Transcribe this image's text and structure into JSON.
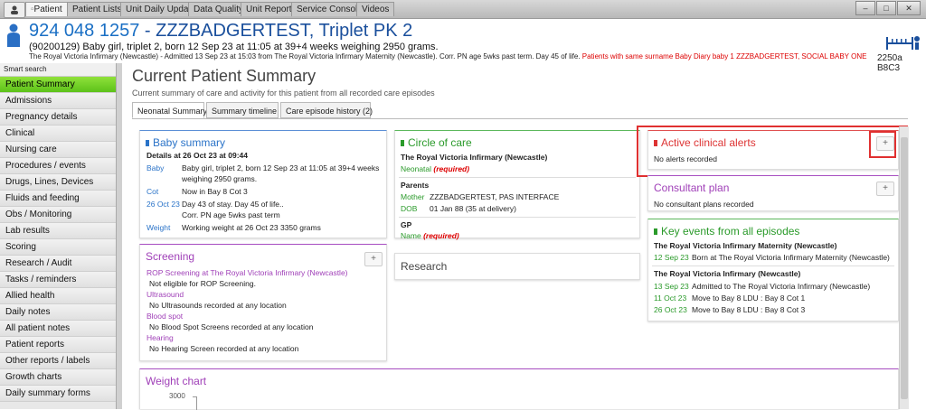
{
  "topbar": {
    "tabs": [
      "Patient",
      "Patient Lists",
      "Unit Daily Update",
      "Data Quality",
      "Unit Reports",
      "Service Console",
      "Videos"
    ],
    "window_buttons": [
      "–",
      "□",
      "✕"
    ]
  },
  "patient": {
    "number": "924 048 1257",
    "name": " - ZZZBADGERTEST, Triplet PK 2",
    "description": "(90200129) Baby girl, triplet 2, born 12 Sep 23 at 11:05 at 39+4 weeks weighing 2950 grams.",
    "admission_line": "The Royal Victoria Infirmary (Newcastle) - Admitted 13 Sep 23 at 15:03 from The Royal Victoria Infirmary Maternity (Newcastle). Corr. PN age 5wks past term. Day 45 of life. ",
    "alert_line": "Patients with same surname Baby Diary baby 1 ZZZBADGERTEST, SOCIAL BABY ONE",
    "bed_code": "2250a B8C3"
  },
  "sidebar": {
    "smart_search": "Smart search",
    "items": [
      "Patient Summary",
      "Admissions",
      "Pregnancy details",
      "Clinical",
      "Nursing care",
      "Procedures / events",
      "Drugs, Lines, Devices",
      "Fluids and feeding",
      "Obs / Monitoring",
      "Lab results",
      "Scoring",
      "Research / Audit",
      "Tasks / reminders",
      "Allied health",
      "Daily notes",
      "All patient notes",
      "Patient reports",
      "Other reports / labels",
      "Growth charts",
      "Daily summary forms"
    ]
  },
  "main": {
    "title": "Current Patient Summary",
    "subtitle": "Current summary of care and activity for this patient from all recorded care episodes",
    "tabs": [
      "Neonatal Summary",
      "Summary timeline",
      "Care episode history (2)"
    ]
  },
  "baby_summary": {
    "title": "Baby summary",
    "details_heading": "Details at 26 Oct 23 at 09:44",
    "rows": [
      {
        "label": "Baby",
        "value": "Baby girl, triplet 2, born 12 Sep 23 at 11:05 at 39+4 weeks"
      },
      {
        "label": "",
        "value": "weighing 2950 grams."
      },
      {
        "label": "Cot",
        "value": "Now in Bay 8 Cot 3"
      },
      {
        "label": "26 Oct 23",
        "value": "Day 43 of stay. Day 45 of life.."
      },
      {
        "label": "",
        "value": "Corr. PN age 5wks past term"
      },
      {
        "label": "Weight",
        "value": "Working weight at 26 Oct 23 3350 grams"
      }
    ]
  },
  "screening": {
    "title": "Screening",
    "add": "+",
    "items": [
      {
        "heading": "ROP Screening at The Royal Victoria Infirmary (Newcastle)",
        "text": "Not eligible for ROP Screening."
      },
      {
        "heading": "Ultrasound",
        "text": "No Ultrasounds recorded at any location"
      },
      {
        "heading": "Blood spot",
        "text": "No Blood Spot Screens recorded at any location"
      },
      {
        "heading": "Hearing",
        "text": "No Hearing Screen recorded at any location"
      }
    ]
  },
  "circle_of_care": {
    "title": "Circle of care",
    "hospital": "The Royal Victoria Infirmary (Newcastle)",
    "neonatal_label": "Neonatal",
    "required": "(required)",
    "parents_heading": "Parents",
    "mother_label": "Mother",
    "mother_value": "ZZZBADGERTEST, PAS INTERFACE",
    "dob_label": "DOB",
    "dob_value": "01 Jan 88 (35 at delivery)",
    "gp_heading": "GP",
    "gp_name_label": "Name",
    "gp_required": "(required)"
  },
  "research": {
    "title": "Research"
  },
  "alerts": {
    "title": "Active clinical alerts",
    "empty": "No alerts recorded",
    "add": "+"
  },
  "consultant": {
    "title": "Consultant plan",
    "empty": "No consultant plans recorded",
    "add": "+"
  },
  "key_events": {
    "title": "Key events from all episodes",
    "groups": [
      {
        "hospital": "The Royal Victoria Infirmary Maternity (Newcastle)",
        "events": [
          {
            "date": "12 Sep 23",
            "text": "Born at The Royal Victoria Infirmary Maternity (Newcastle)"
          }
        ]
      },
      {
        "hospital": "The Royal Victoria Infirmary (Newcastle)",
        "events": [
          {
            "date": "13 Sep 23",
            "text": "Admitted to The Royal Victoria Infirmary (Newcastle)"
          },
          {
            "date": "11 Oct 23",
            "text": "Move to Bay 8 LDU : Bay 8 Cot 1"
          },
          {
            "date": "26 Oct 23",
            "text": "Move to Bay 8 LDU : Bay 8 Cot 3"
          }
        ]
      }
    ]
  },
  "weight_chart": {
    "title": "Weight chart",
    "y_tick": "3000"
  },
  "colors": {
    "accent_green": "#7ed321",
    "alert_red": "#d00000",
    "link_blue": "#2a73c8"
  }
}
